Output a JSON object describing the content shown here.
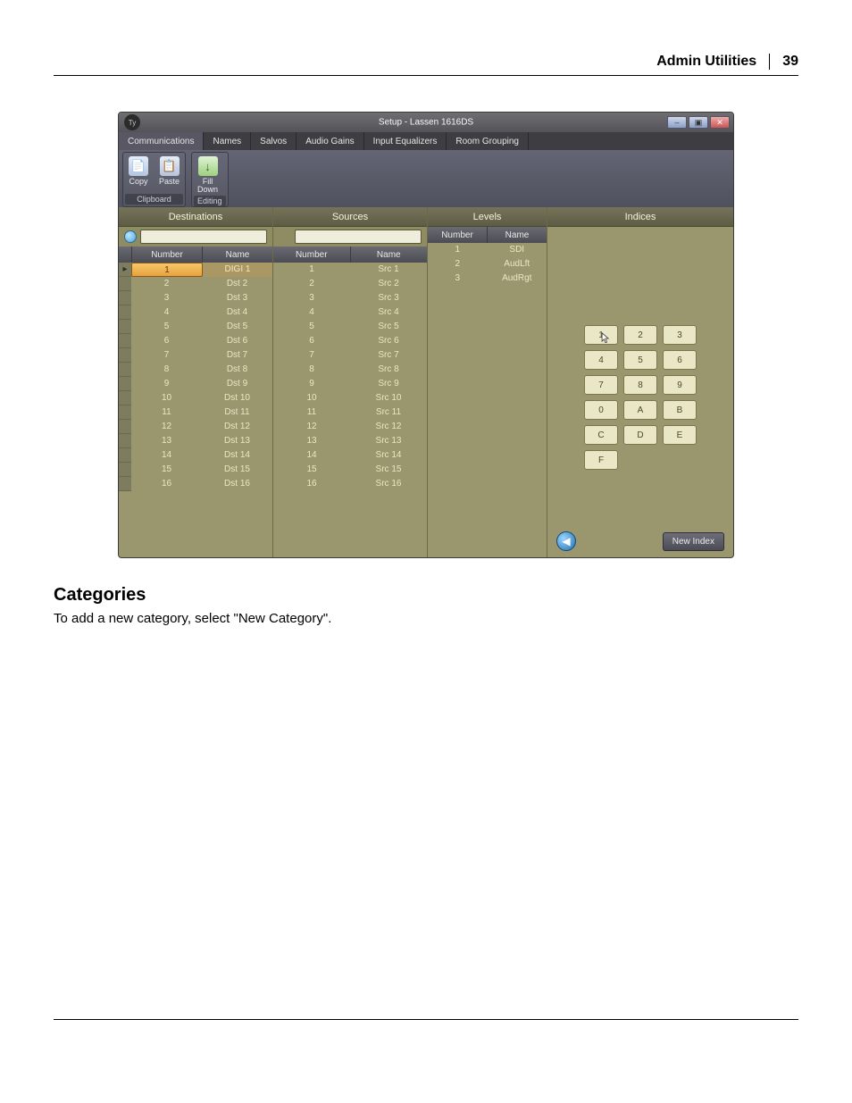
{
  "page": {
    "header_title": "Admin Utilities",
    "page_number": "39"
  },
  "window": {
    "title": "Setup - Lassen 1616DS",
    "btn_min": "–",
    "btn_max": "▣",
    "btn_close": "✕",
    "logo": "Ty"
  },
  "tabs": {
    "items": [
      {
        "label": "Communications",
        "active": true
      },
      {
        "label": "Names",
        "active": false
      },
      {
        "label": "Salvos",
        "active": false
      },
      {
        "label": "Audio Gains",
        "active": false
      },
      {
        "label": "Input Equalizers",
        "active": false
      },
      {
        "label": "Room Grouping",
        "active": false
      }
    ]
  },
  "ribbon": {
    "groups": [
      {
        "label": "Clipboard",
        "buttons": [
          {
            "label": "Copy",
            "icon": "📄"
          },
          {
            "label": "Paste",
            "icon": "📋"
          }
        ]
      },
      {
        "label": "Editing",
        "buttons": [
          {
            "label": "Fill Down",
            "icon": "↓",
            "green": true
          }
        ]
      }
    ]
  },
  "panels": {
    "destinations": {
      "title": "Destinations",
      "col_number": "Number",
      "col_name": "Name",
      "rows": [
        {
          "num": "1",
          "name": "DIGI 1",
          "selected": true
        },
        {
          "num": "2",
          "name": "Dst 2"
        },
        {
          "num": "3",
          "name": "Dst 3"
        },
        {
          "num": "4",
          "name": "Dst 4"
        },
        {
          "num": "5",
          "name": "Dst 5"
        },
        {
          "num": "6",
          "name": "Dst 6"
        },
        {
          "num": "7",
          "name": "Dst 7"
        },
        {
          "num": "8",
          "name": "Dst 8"
        },
        {
          "num": "9",
          "name": "Dst 9"
        },
        {
          "num": "10",
          "name": "Dst 10"
        },
        {
          "num": "11",
          "name": "Dst 11"
        },
        {
          "num": "12",
          "name": "Dst 12"
        },
        {
          "num": "13",
          "name": "Dst 13"
        },
        {
          "num": "14",
          "name": "Dst 14"
        },
        {
          "num": "15",
          "name": "Dst 15"
        },
        {
          "num": "16",
          "name": "Dst 16"
        }
      ]
    },
    "sources": {
      "title": "Sources",
      "col_number": "Number",
      "col_name": "Name",
      "rows": [
        {
          "num": "1",
          "name": "Src 1"
        },
        {
          "num": "2",
          "name": "Src 2"
        },
        {
          "num": "3",
          "name": "Src 3"
        },
        {
          "num": "4",
          "name": "Src 4"
        },
        {
          "num": "5",
          "name": "Src 5"
        },
        {
          "num": "6",
          "name": "Src 6"
        },
        {
          "num": "7",
          "name": "Src 7"
        },
        {
          "num": "8",
          "name": "Src 8"
        },
        {
          "num": "9",
          "name": "Src 9"
        },
        {
          "num": "10",
          "name": "Src 10"
        },
        {
          "num": "11",
          "name": "Src 11"
        },
        {
          "num": "12",
          "name": "Src 12"
        },
        {
          "num": "13",
          "name": "Src 13"
        },
        {
          "num": "14",
          "name": "Src 14"
        },
        {
          "num": "15",
          "name": "Src 15"
        },
        {
          "num": "16",
          "name": "Src 16"
        }
      ]
    },
    "levels": {
      "title": "Levels",
      "col_number": "Number",
      "col_name": "Name",
      "rows": [
        {
          "num": "1",
          "name": "SDI"
        },
        {
          "num": "2",
          "name": "AudLft"
        },
        {
          "num": "3",
          "name": "AudRgt"
        }
      ]
    },
    "indices": {
      "title": "Indices",
      "keys": [
        "1",
        "2",
        "3",
        "4",
        "5",
        "6",
        "7",
        "8",
        "9",
        "0",
        "A",
        "B",
        "C",
        "D",
        "E",
        "F"
      ],
      "back": "◀",
      "new_index": "New Index"
    }
  },
  "body_text": {
    "heading": "Categories",
    "para": "To add a new category, select \"New Category\"."
  }
}
